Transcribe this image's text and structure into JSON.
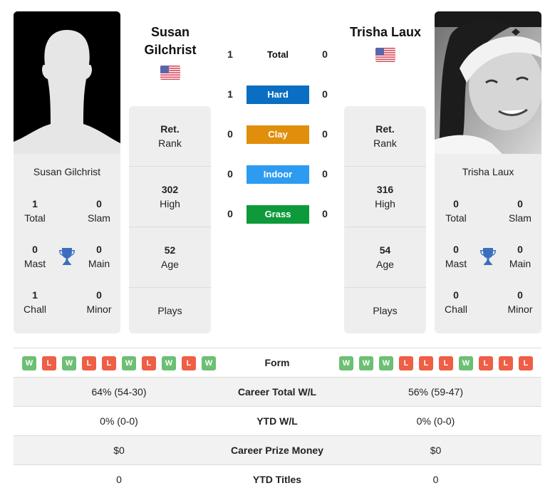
{
  "colors": {
    "hard": "#0a6fc2",
    "clay": "#e08e0b",
    "indoor": "#2d9cf0",
    "grass": "#0e9a3a",
    "win": "#6cbf73",
    "loss": "#ef5e45",
    "trophy": "#3b6ebd"
  },
  "player1": {
    "name": "Susan Gilchrist",
    "name_line1": "Susan",
    "name_line2": "Gilchrist",
    "flag": "usa-flag",
    "photo": "silhouette-placeholder",
    "titles": {
      "total": {
        "value": "1",
        "label": "Total"
      },
      "slam": {
        "value": "0",
        "label": "Slam"
      },
      "mast": {
        "value": "0",
        "label": "Mast"
      },
      "main": {
        "value": "0",
        "label": "Main"
      },
      "chall": {
        "value": "1",
        "label": "Chall"
      },
      "minor": {
        "value": "0",
        "label": "Minor"
      }
    },
    "rank": {
      "value": "Ret.",
      "label": "Rank"
    },
    "high": {
      "value": "302",
      "label": "High"
    },
    "age": {
      "value": "52",
      "label": "Age"
    },
    "plays": {
      "value": "",
      "label": "Plays"
    },
    "form": [
      "W",
      "L",
      "W",
      "L",
      "L",
      "W",
      "L",
      "W",
      "L",
      "W"
    ],
    "career_wl": "64% (54-30)",
    "ytd_wl": "0% (0-0)",
    "prize_money": "$0",
    "ytd_titles": "0"
  },
  "player2": {
    "name": "Trisha Laux",
    "flag": "usa-flag",
    "photo": "player-photo",
    "titles": {
      "total": {
        "value": "0",
        "label": "Total"
      },
      "slam": {
        "value": "0",
        "label": "Slam"
      },
      "mast": {
        "value": "0",
        "label": "Mast"
      },
      "main": {
        "value": "0",
        "label": "Main"
      },
      "chall": {
        "value": "0",
        "label": "Chall"
      },
      "minor": {
        "value": "0",
        "label": "Minor"
      }
    },
    "rank": {
      "value": "Ret.",
      "label": "Rank"
    },
    "high": {
      "value": "316",
      "label": "High"
    },
    "age": {
      "value": "54",
      "label": "Age"
    },
    "plays": {
      "value": "",
      "label": "Plays"
    },
    "form": [
      "W",
      "W",
      "W",
      "L",
      "L",
      "L",
      "W",
      "L",
      "L",
      "L"
    ],
    "career_wl": "56% (59-47)",
    "ytd_wl": "0% (0-0)",
    "prize_money": "$0",
    "ytd_titles": "0"
  },
  "h2h": [
    {
      "label": "Total",
      "p1": "1",
      "p2": "0",
      "key": "total"
    },
    {
      "label": "Hard",
      "p1": "1",
      "p2": "0",
      "key": "hard"
    },
    {
      "label": "Clay",
      "p1": "0",
      "p2": "0",
      "key": "clay"
    },
    {
      "label": "Indoor",
      "p1": "0",
      "p2": "0",
      "key": "indoor"
    },
    {
      "label": "Grass",
      "p1": "0",
      "p2": "0",
      "key": "grass"
    }
  ],
  "comparison": {
    "form_label": "Form",
    "career_wl_label": "Career Total W/L",
    "ytd_wl_label": "YTD W/L",
    "prize_label": "Career Prize Money",
    "ytd_titles_label": "YTD Titles"
  }
}
